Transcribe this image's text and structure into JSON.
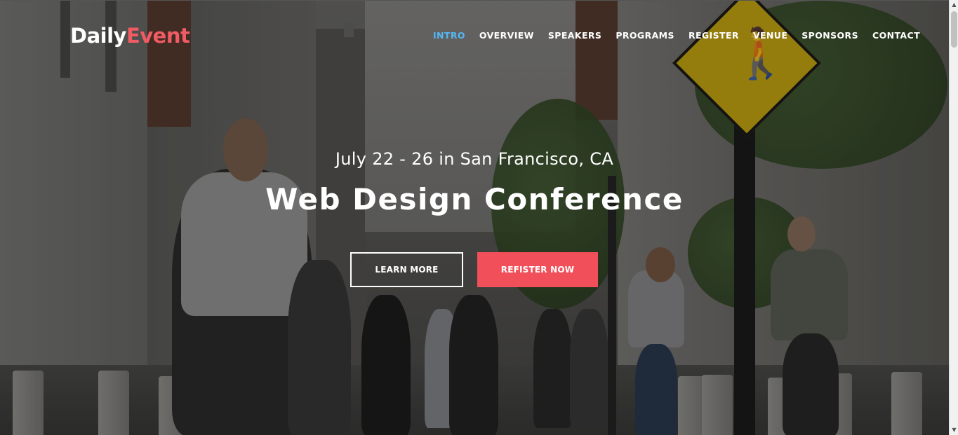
{
  "logo": {
    "part1": "Daily",
    "part2": "Event"
  },
  "nav": {
    "items": [
      {
        "label": "INTRO",
        "active": true
      },
      {
        "label": "OVERVIEW"
      },
      {
        "label": "SPEAKERS"
      },
      {
        "label": "PROGRAMS"
      },
      {
        "label": "REGISTER"
      },
      {
        "label": "VENUE"
      },
      {
        "label": "SPONSORS"
      },
      {
        "label": "CONTACT"
      }
    ]
  },
  "hero": {
    "subtitle": "July 22 - 26 in San Francisco, CA",
    "title": "Web Design Conference",
    "learn_more": "LEARN MORE",
    "register_now": "REFISTER NOW"
  },
  "colors": {
    "accent": "#f15b63",
    "nav_active": "#55b8f4",
    "button_solid": "#f1505a"
  },
  "scrollbar": {
    "up_icon": "triangle-up",
    "down_icon": "triangle-down"
  }
}
